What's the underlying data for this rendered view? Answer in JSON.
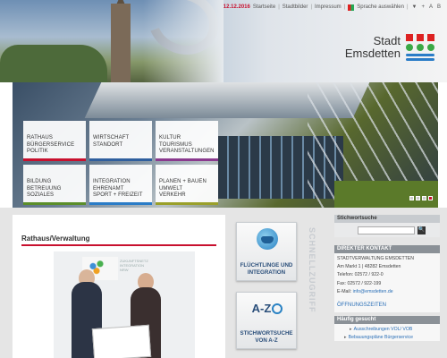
{
  "utility": {
    "date": "12.12.2016",
    "links": [
      "Startseite",
      "Stadtbilder",
      "Impressum"
    ],
    "language": "Sprache auswählen",
    "tools": [
      "▼",
      "+",
      "A",
      "B"
    ]
  },
  "logo": {
    "line1": "Stadt",
    "line2": "Emsdetten"
  },
  "colors": {
    "accent_red": "#c8102e",
    "link_blue": "#2a6fb7",
    "logo_green": "#39a845",
    "logo_blue": "#2a7cc7"
  },
  "nav_tiles": [
    {
      "lines": [
        "RATHAUS",
        "BÜRGERSERVICE",
        "POLITIK"
      ]
    },
    {
      "lines": [
        "WIRTSCHAFT",
        "STANDORT"
      ]
    },
    {
      "lines": [
        "KULTUR",
        "TOURISMUS",
        "VERANSTALTUNGEN"
      ]
    },
    {
      "lines": [
        "BILDUNG",
        "BETREUUNG",
        "SOZIALES"
      ]
    },
    {
      "lines": [
        "INTEGRATION",
        "EHRENAMT",
        "SPORT + FREIZEIT"
      ]
    },
    {
      "lines": [
        "PLANEN + BAUEN",
        "UMWELT",
        "VERKEHR"
      ]
    }
  ],
  "slider": {
    "slide_count": 4,
    "active_slide": 4
  },
  "main": {
    "title": "Rathaus/Verwaltung",
    "photo_board": [
      "ZUKUNFTSNETZ",
      "INTEGRATION",
      "NRW"
    ]
  },
  "quick": {
    "label": "Schnellzugriff",
    "fluechtlinge": [
      "FLÜCHTLINGE UND",
      "INTEGRATION"
    ],
    "stichwort": [
      "STICHWORTSUCHE",
      "VON A-Z"
    ],
    "az_icon_text": "A-Z"
  },
  "sidebar": {
    "search_head": "Stichwortsuche",
    "search_button": "🔍",
    "contact_head": "DIREKTER KONTAKT",
    "contact": {
      "org": "Stadtverwaltung Emsdetten",
      "street": "Am Markt 1 | 48282 Emsdetten",
      "phone": "Telefon: 02572 / 922-0",
      "fax": "Fax: 02572 / 922-199",
      "email_label": "E-Mail:",
      "email": "info@emsdetten.de"
    },
    "hours": "ÖFFNUNGSZEITEN",
    "freq_head": "Häufig gesucht",
    "freq_items": [
      "Ausschreibungen VOL/ VOB",
      "Bebauungspläne",
      "Bürgerservice"
    ]
  }
}
